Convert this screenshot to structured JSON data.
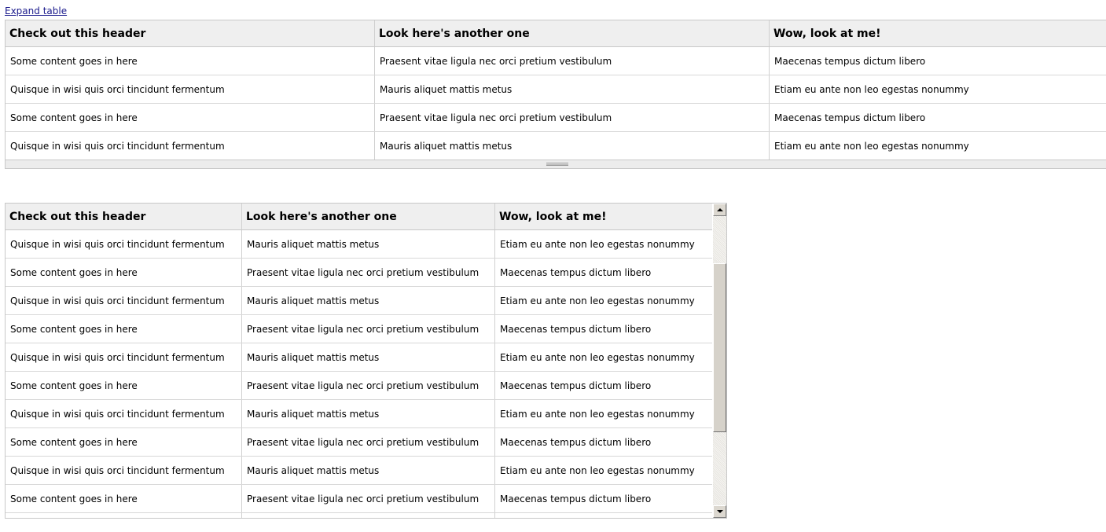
{
  "expand_link": "Expand table",
  "headers": [
    "Check out this header",
    "Look here's another one",
    "Wow, look at me!"
  ],
  "table1": {
    "rows": [
      [
        "Some content goes in here",
        "Praesent vitae ligula nec orci pretium vestibulum",
        "Maecenas tempus dictum libero"
      ],
      [
        "Quisque in wisi quis orci tincidunt fermentum",
        "Mauris aliquet mattis metus",
        "Etiam eu ante non leo egestas nonummy"
      ],
      [
        "Some content goes in here",
        "Praesent vitae ligula nec orci pretium vestibulum",
        "Maecenas tempus dictum libero"
      ],
      [
        "Quisque in wisi quis orci tincidunt fermentum",
        "Mauris aliquet mattis metus",
        "Etiam eu ante non leo egestas nonummy"
      ]
    ]
  },
  "table2": {
    "rows": [
      [
        "Quisque in wisi quis orci tincidunt fermentum",
        "Mauris aliquet mattis metus",
        "Etiam eu ante non leo egestas nonummy"
      ],
      [
        "Some content goes in here",
        "Praesent vitae ligula nec orci pretium vestibulum",
        "Maecenas tempus dictum libero"
      ],
      [
        "Quisque in wisi quis orci tincidunt fermentum",
        "Mauris aliquet mattis metus",
        "Etiam eu ante non leo egestas nonummy"
      ],
      [
        "Some content goes in here",
        "Praesent vitae ligula nec orci pretium vestibulum",
        "Maecenas tempus dictum libero"
      ],
      [
        "Quisque in wisi quis orci tincidunt fermentum",
        "Mauris aliquet mattis metus",
        "Etiam eu ante non leo egestas nonummy"
      ],
      [
        "Some content goes in here",
        "Praesent vitae ligula nec orci pretium vestibulum",
        "Maecenas tempus dictum libero"
      ],
      [
        "Quisque in wisi quis orci tincidunt fermentum",
        "Mauris aliquet mattis metus",
        "Etiam eu ante non leo egestas nonummy"
      ],
      [
        "Some content goes in here",
        "Praesent vitae ligula nec orci pretium vestibulum",
        "Maecenas tempus dictum libero"
      ],
      [
        "Quisque in wisi quis orci tincidunt fermentum",
        "Mauris aliquet mattis metus",
        "Etiam eu ante non leo egestas nonummy"
      ],
      [
        "Some content goes in here",
        "Praesent vitae ligula nec orci pretium vestibulum",
        "Maecenas tempus dictum libero"
      ],
      [
        "",
        "",
        ""
      ]
    ]
  }
}
